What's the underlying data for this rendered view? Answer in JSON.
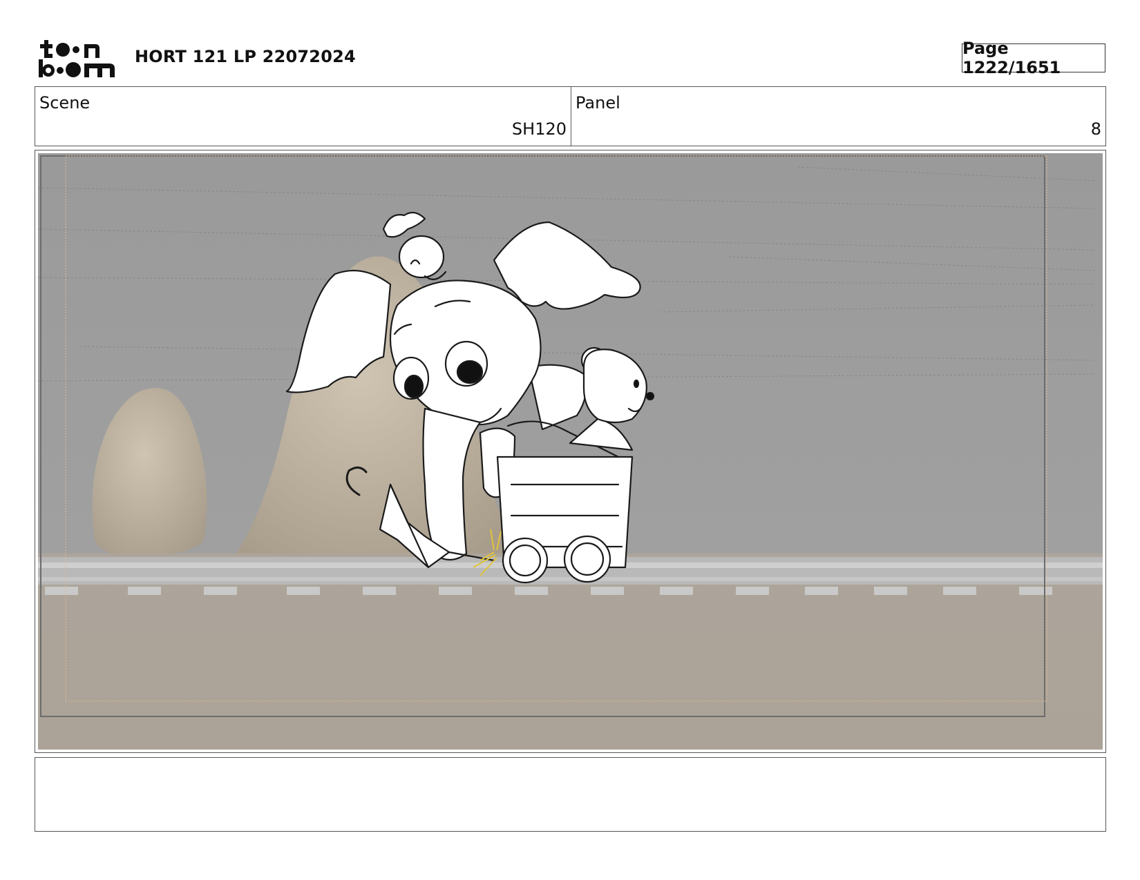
{
  "header": {
    "logo_text": "toon boom",
    "title": "HORT 121 LP 22072024",
    "page": "Page 1222/1651"
  },
  "info": {
    "scene_label": "Scene",
    "scene_value": "SH120",
    "panel_label": "Panel",
    "panel_value": "8"
  },
  "notes": {
    "text": ""
  }
}
